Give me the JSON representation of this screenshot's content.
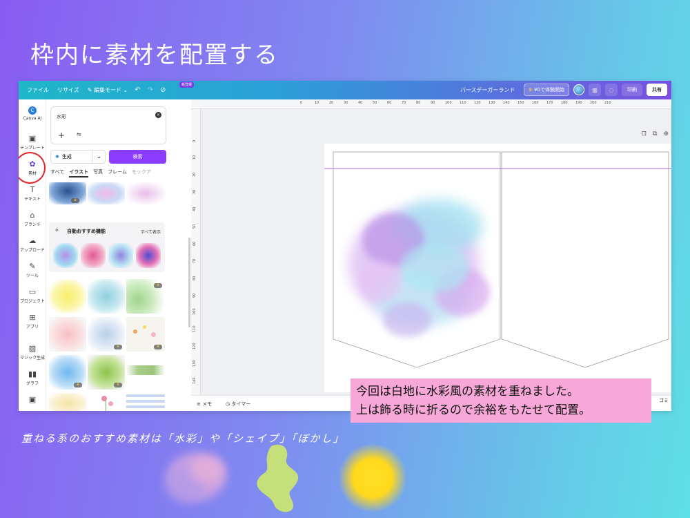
{
  "slide": {
    "title": "枠内に素材を配置する",
    "caption_line1": "今回は白地に水彩風の素材を重ねました。",
    "caption_line2": "上は飾る時に折るので余裕をもたせて配置。",
    "subtitle": "重ねる系のおすすめ素材は「水彩」や「シェイプ」「ぼかし」"
  },
  "topbar": {
    "file": "ファイル",
    "resize": "リサイズ",
    "edit_mode": "編集モード",
    "new_badge": "新登場",
    "design_name": "バースデーガーランド",
    "trial": "¥0で体験開始",
    "print": "印刷",
    "share": "共有"
  },
  "rail": {
    "items": [
      {
        "label": "Canva AI",
        "icon": "canva-ai-icon"
      },
      {
        "label": "テンプレート",
        "icon": "template-icon"
      },
      {
        "label": "素材",
        "icon": "elements-icon"
      },
      {
        "label": "テキスト",
        "icon": "text-icon"
      },
      {
        "label": "ブランド",
        "icon": "brand-icon"
      },
      {
        "label": "アップロード",
        "icon": "upload-icon"
      },
      {
        "label": "ツール",
        "icon": "draw-icon"
      },
      {
        "label": "プロジェクト",
        "icon": "folder-icon"
      },
      {
        "label": "アプリ",
        "icon": "apps-icon"
      },
      {
        "label": "マジック生成",
        "icon": "magic-icon"
      },
      {
        "label": "グラフ",
        "icon": "chart-icon"
      }
    ]
  },
  "panel": {
    "search_value": "水彩",
    "generate_label": "生成",
    "search_button": "検索",
    "tabs": [
      "すべて",
      "イラスト",
      "写真",
      "フレーム",
      "モックア"
    ],
    "active_tab": "イラスト",
    "auto_title": "自動おすすめ機能",
    "auto_see_all": "すべて表示"
  },
  "ruler": {
    "top": [
      "0",
      "10",
      "20",
      "30",
      "40",
      "50",
      "60",
      "70",
      "80",
      "90",
      "100",
      "110",
      "120",
      "130",
      "140",
      "150",
      "160",
      "170",
      "180",
      "190",
      "200",
      "210"
    ],
    "left": [
      "0",
      "10",
      "20",
      "30",
      "40",
      "50",
      "60",
      "70",
      "80",
      "90",
      "100",
      "110",
      "120",
      "130",
      "140"
    ]
  },
  "bottombar": {
    "memo": "メモ",
    "timer": "タイマー",
    "trash": "ゴミ"
  },
  "colors": {
    "accent": "#8b3dff",
    "highlight_circle": "#e2262a",
    "caption_bg": "#f7a8d8"
  }
}
